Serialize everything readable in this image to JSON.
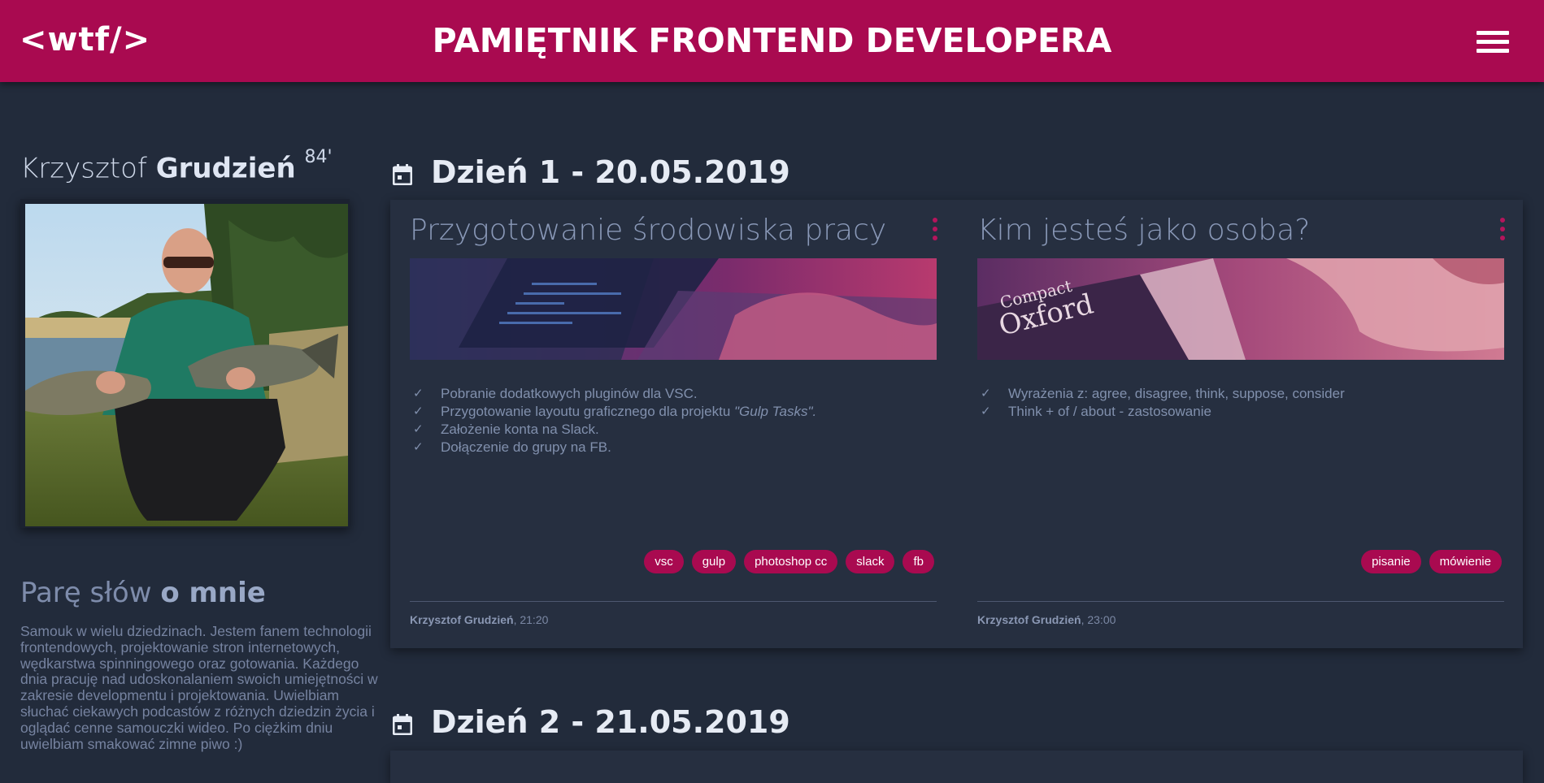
{
  "header": {
    "logo": "<wtf/>",
    "title": "PAMIĘTNIK FRONTEND DEVELOPERA",
    "menu_icon": "hamburger-menu-icon"
  },
  "sidebar": {
    "first_name": "Krzysztof",
    "last_name": "Grudzień",
    "year": "84'",
    "about_title_a": "Parę słów",
    "about_title_b": "o mnie",
    "about_text": "Samouk w wielu dziedzinach. Jestem fanem technologii frontendowych, projektowanie stron internetowych, wędkarstwa spinningowego oraz gotowania. Każdego dnia pracuję nad udoskonalaniem swoich umiejętności w zakresie developmentu i projektowania. Uwielbiam słuchać ciekawych podcastów z różnych dziedzin życia i oglądać cenne samouczki wideo. Po ciężkim dniu uwielbiam smakować zimne piwo :)"
  },
  "days": [
    {
      "title": "Dzień 1 - 20.05.2019",
      "icon": "calendar-icon",
      "entries": [
        {
          "title": "Przygotowanie środowiska pracy",
          "tasks": [
            "Pobranie dodatkowych pluginów dla VSC.",
            "Przygotowanie layoutu graficznego dla projektu",
            "Założenie konta na Slack.",
            "Dołączenie do grupy na FB."
          ],
          "task2_project": "\"Gulp Tasks\".",
          "tags": [
            "vsc",
            "gulp",
            "photoshop cc",
            "slack",
            "fb"
          ],
          "author": "Krzysztof Grudzień",
          "time": ", 21:20"
        },
        {
          "title": "Kim jesteś jako osoba?",
          "tasks": [
            "Wyrażenia z: agree, disagree, think, suppose, consider",
            "Think + of / about - zastosowanie"
          ],
          "tags": [
            "pisanie",
            "mówienie"
          ],
          "author": "Krzysztof Grudzień",
          "time": ", 23:00"
        }
      ]
    },
    {
      "title": "Dzień 2 - 21.05.2019",
      "icon": "calendar-icon"
    }
  ],
  "colors": {
    "accent": "#a90a50",
    "background": "#222b3b",
    "card": "#262f40"
  }
}
